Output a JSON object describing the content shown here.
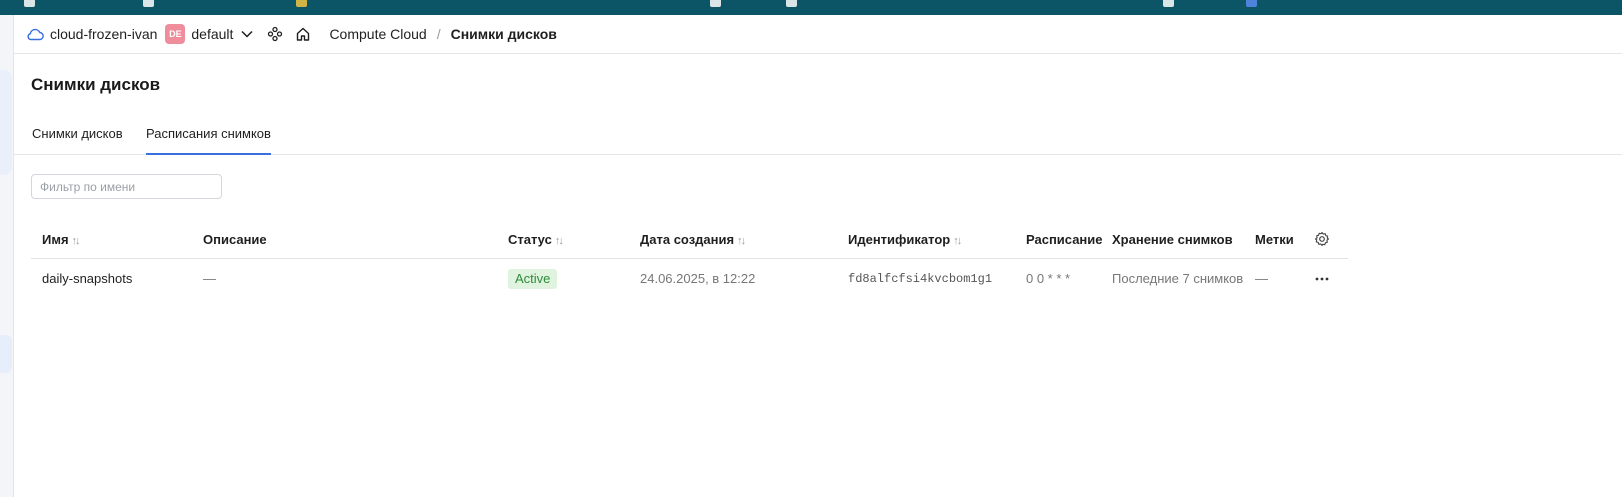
{
  "header": {
    "cloud_name": "cloud-frozen-ivan",
    "folder_badge": "DE",
    "folder_name": "default",
    "breadcrumb": [
      "Compute Cloud",
      "Снимки дисков"
    ],
    "separator": "/"
  },
  "page": {
    "title": "Снимки дисков"
  },
  "tabs": [
    {
      "label": "Снимки дисков",
      "active": false
    },
    {
      "label": "Расписания снимков",
      "active": true
    }
  ],
  "filter": {
    "placeholder": "Фильтр по имени",
    "value": ""
  },
  "table": {
    "columns": [
      "Имя",
      "Описание",
      "Статус",
      "Дата создания",
      "Идентификатор",
      "Расписание",
      "Хранение снимков",
      "Метки"
    ],
    "sort_glyph": "↑↓",
    "rows": [
      {
        "name": "daily-snapshots",
        "description": "—",
        "status": "Active",
        "created": "24.06.2025, в 12:22",
        "id": "fd8alfcfsi4kvcbom1g1",
        "schedule": "0 0 * * *",
        "retention": "Последние 7 снимков",
        "labels": "—"
      }
    ]
  },
  "colors": {
    "accent": "#3a6fe0",
    "topbar": "#0b5567",
    "status_active_bg": "#dff3df",
    "status_active_fg": "#2f8b3a",
    "badge_de": "#ef8d9c"
  }
}
